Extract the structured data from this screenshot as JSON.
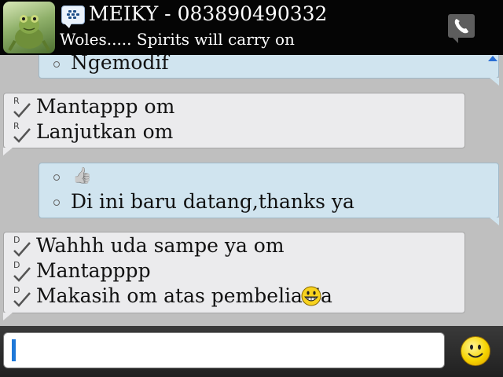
{
  "header": {
    "contact_name": "MEIKY - 083890490332",
    "status": "Woles.....  Spirits will carry on",
    "avatar_icon": "frog-avatar",
    "bbm_icon": "bbm-chat-icon",
    "call_icon": "phone-icon"
  },
  "messages": [
    {
      "dir": "sent",
      "lines": [
        {
          "text": "Ngemodif"
        }
      ]
    },
    {
      "dir": "received",
      "lines": [
        {
          "status": "R",
          "text": "Mantappp om"
        },
        {
          "status": "R",
          "text": "Lanjutkan om"
        }
      ]
    },
    {
      "dir": "sent",
      "lines": [
        {
          "emoticon": "thumbs-up",
          "text": "👍"
        },
        {
          "text": "Di ini baru datang,thanks ya"
        }
      ]
    },
    {
      "dir": "received",
      "lines": [
        {
          "status": "D",
          "text": "Wahhh uda sampe ya om"
        },
        {
          "status": "D",
          "text": "Mantapppp"
        },
        {
          "status": "D",
          "text": "Makasih om atas pembelian'a",
          "emoticon": "grin"
        }
      ]
    }
  ],
  "composer": {
    "value": "",
    "emoticon_button_icon": "smiley-icon"
  },
  "colors": {
    "header_bg": "#050505",
    "chat_bg": "#bfbfbf",
    "sent_bubble": "#d0e4ef",
    "received_bubble": "#ebebed",
    "cursor": "#1e78d8"
  }
}
